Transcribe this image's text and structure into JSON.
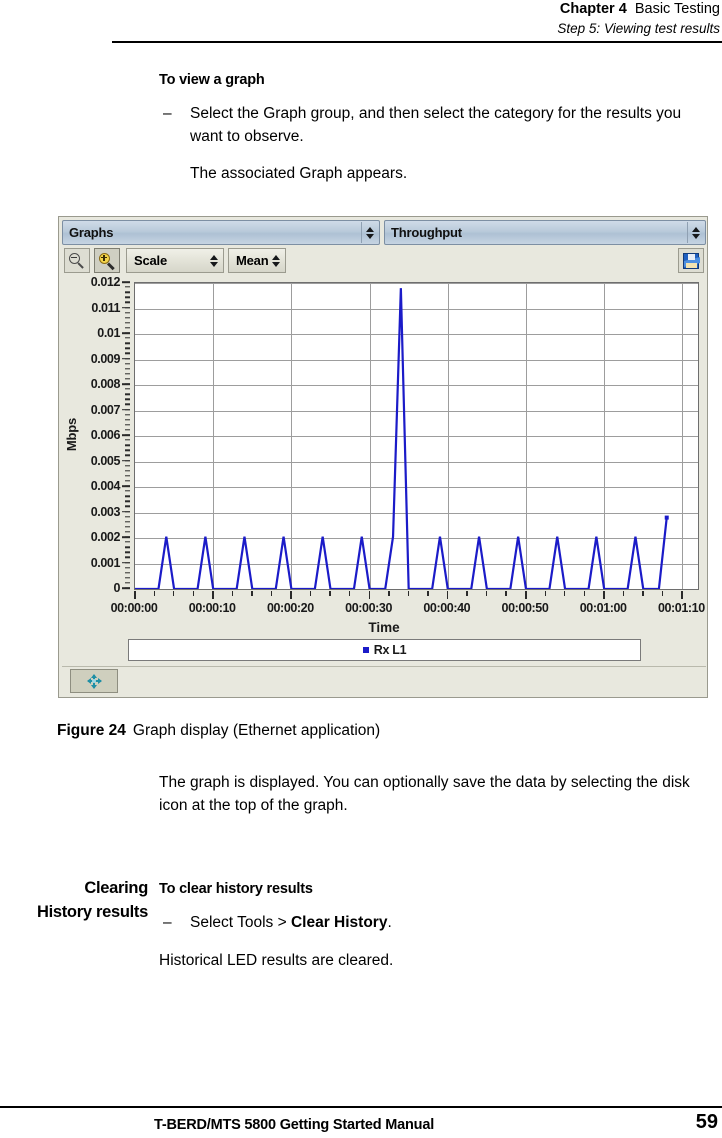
{
  "running_head": {
    "chapter_number": "Chapter 4",
    "chapter_title": "Basic Testing",
    "section": "Step 5: Viewing test results"
  },
  "sections": {
    "view_graph": {
      "heading": "To view a graph",
      "dash": "–",
      "step": "Select the Graph group, and then select the category for the results you want to observe.",
      "result": "The associated Graph appears."
    },
    "after_figure": {
      "text": "The graph is displayed. You can optionally save the data by selecting the disk icon at the top of the graph."
    },
    "clearing": {
      "side_head_line1": "Clearing",
      "side_head_line2": "History results",
      "heading": "To clear history results",
      "dash": "–",
      "step_prefix": "Select Tools > ",
      "step_bold": "Clear History",
      "step_suffix": ".",
      "result": "Historical LED results are cleared."
    }
  },
  "figure": {
    "label": "Figure 24",
    "caption": "Graph display (Ethernet application)"
  },
  "screenshot": {
    "group_combo": {
      "value": "Graphs",
      "spinner_icon": "spinner-up-down-icon"
    },
    "category_combo": {
      "value": "Throughput",
      "spinner_icon": "spinner-up-down-icon"
    },
    "toolbar": {
      "zoom_out_icon": "magnifier-minus-icon",
      "zoom_in_icon": "magnifier-plus-icon",
      "scale_select": "Scale",
      "stat_select": "Mean",
      "save_icon": "floppy-disk-icon"
    },
    "status_bar": {
      "pan_icon": "four-way-arrow-icon"
    }
  },
  "chart_data": {
    "type": "line",
    "title": "",
    "xlabel": "Time",
    "ylabel": "Mbps",
    "ylim": [
      0,
      0.012
    ],
    "yticks": [
      0,
      0.001,
      0.002,
      0.003,
      0.004,
      0.005,
      0.006,
      0.007,
      0.008,
      0.009,
      0.01,
      0.011,
      0.012
    ],
    "ytick_labels": [
      "0",
      "0.001",
      "0.002",
      "0.003",
      "0.004",
      "0.005",
      "0.006",
      "0.007",
      "0.008",
      "0.009",
      "0.01",
      "0.011",
      "0.012"
    ],
    "xlim_seconds": [
      0,
      72
    ],
    "xticks_seconds": [
      0,
      10,
      20,
      30,
      40,
      50,
      60,
      70
    ],
    "xtick_labels": [
      "00:00:00",
      "00:00:10",
      "00:00:20",
      "00:00:30",
      "00:00:40",
      "00:00:50",
      "00:01:00",
      "00:01:10"
    ],
    "grid": true,
    "legend_position": "bottom",
    "series": [
      {
        "name": "Rx L1",
        "color": "#1b1bc8",
        "x": [
          0,
          1,
          2,
          3,
          4,
          5,
          6,
          7,
          8,
          9,
          10,
          11,
          12,
          13,
          14,
          15,
          16,
          17,
          18,
          19,
          20,
          21,
          22,
          23,
          24,
          25,
          26,
          27,
          28,
          29,
          30,
          31,
          32,
          33,
          34,
          35,
          36,
          37,
          38,
          39,
          40,
          41,
          42,
          43,
          44,
          45,
          46,
          47,
          48,
          49,
          50,
          51,
          52,
          53,
          54,
          55,
          56,
          57,
          58,
          59,
          60,
          61,
          62,
          63,
          64,
          65,
          66,
          67,
          68
        ],
        "values": [
          0,
          0,
          0,
          0,
          0.00205,
          0,
          0,
          0,
          0,
          0.00205,
          0,
          0,
          0,
          0,
          0.00205,
          0,
          0,
          0,
          0,
          0.00205,
          0,
          0,
          0,
          0,
          0.00205,
          0,
          0,
          0,
          0,
          0.00205,
          0,
          0,
          0,
          0.00205,
          0.0118,
          0,
          0,
          0,
          0,
          0.00205,
          0,
          0,
          0,
          0,
          0.00205,
          0,
          0,
          0,
          0,
          0.00205,
          0,
          0,
          0,
          0,
          0.00205,
          0,
          0,
          0,
          0,
          0.00205,
          0,
          0,
          0,
          0,
          0.00205,
          0,
          0,
          0,
          0.0028
        ]
      }
    ]
  },
  "footer": {
    "title": "T-BERD/MTS 5800 Getting Started Manual",
    "page": "59"
  }
}
